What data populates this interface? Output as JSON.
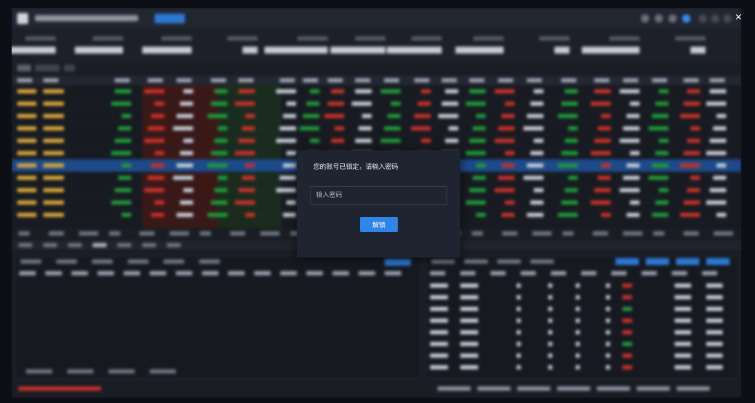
{
  "lock_dialog": {
    "message": "您的账号已锁定，请输入密码",
    "password_placeholder": "输入密码",
    "unlock_label": "解锁"
  },
  "window": {
    "close_glyph": "×"
  },
  "colors": {
    "accent": "#2f86e8",
    "dialog_bg": "#1e2430",
    "selected_row": "#1c4a8a",
    "up_red": "#c8322a",
    "down_green": "#1f9a3a",
    "code_yellow": "#d6a63b"
  },
  "icons": [
    "app-logo-icon",
    "close-icon"
  ]
}
